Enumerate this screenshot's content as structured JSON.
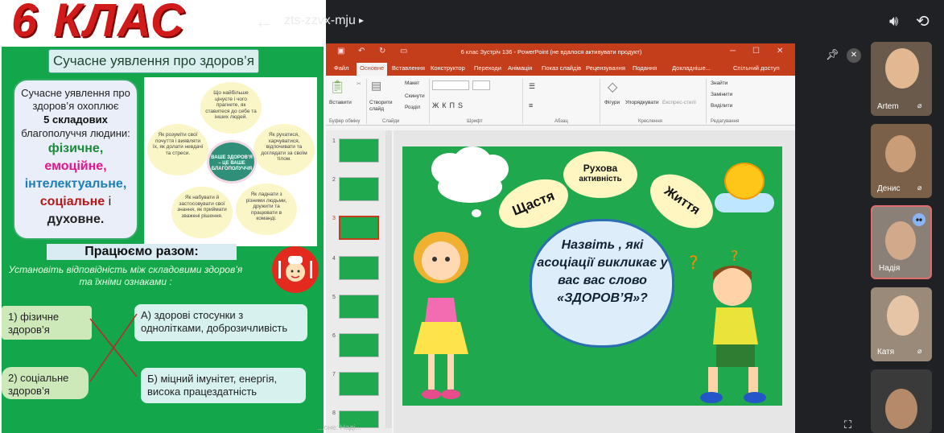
{
  "meeting": {
    "code": "zts-zzvx-mju",
    "participants": [
      {
        "name": "Artem"
      },
      {
        "name": "Денис"
      },
      {
        "name": "Надія"
      },
      {
        "name": "Катя"
      },
      {
        "name": ""
      }
    ],
    "presenter_caption": "...оне: Наді..."
  },
  "lesson": {
    "grade_title": "6 КЛАС",
    "topic_title": "Сучасне уявлення про здоров’я",
    "info": {
      "line1": "Сучасне уявлення про",
      "line2": "здоров’я охоплює",
      "bold": "5 складових",
      "line3": "благополуччя людини:",
      "c1": "фізичне,",
      "c2": "емоційне,",
      "c3": "інтелектуальне,",
      "c4": "соціальне",
      "c4b": " і",
      "c5": "духовне."
    },
    "flower": {
      "center": "ВАШЕ ЗДОРОВ’Я – ЦЕ ВАШЕ БЛАГОПОЛУЧЧЯ",
      "p1": "Що найбільше цінуєте і чого прагнете, як ставитеся до себе та інших людей.",
      "p2": "Як рухатися, харчуватися, відпочивати та доглядати за своїм тілом.",
      "p3": "Як ладнати з різними людьми, дружити та працювати в команді.",
      "p4": "Як набувати й застосовувати свої знання, як приймати зважені рішення.",
      "p5": "Як розуміти свої почуття і виявляти їх, як долати невдачі та стреси."
    },
    "work_title": "Працюємо разом:",
    "instruction": "Установіть відповідність між складовими здоров’я та їхніми ознаками :",
    "match": {
      "m1": "1) фізичне здоров’я",
      "m2": "2) соціальне здоров’я",
      "m3": "А) здорові стосунки з однолітками, доброзичливість",
      "m4": "Б) міцний імунітет, енергія, висока працездатність"
    }
  },
  "ppt": {
    "title": "6 клас Зустріч 136 - PowerPoint (не вдалося активувати продукт)",
    "tabs": [
      "Файл",
      "Основне",
      "Вставлення",
      "Конструктор",
      "Переходи",
      "Анімація",
      "Показ слайдів",
      "Рецензування",
      "Подання",
      "Докладніше...",
      "Спільний доступ"
    ],
    "ribbon": {
      "paste": "Вставити",
      "new_slide": "Створити слайд",
      "layout": "Макет",
      "reset": "Скинути",
      "section": "Розділ",
      "shapes": "Фігури",
      "arrange": "Упорядкувати",
      "quick_styles": "Експрес-стилі",
      "find": "Знайти",
      "replace": "Замінити",
      "select": "Виділити",
      "groups": [
        "Буфер обміну",
        "Слайди",
        "Шрифт",
        "Абзац",
        "Креслення",
        "Редагування"
      ]
    },
    "slide_numbers": [
      "1",
      "2",
      "3",
      "4",
      "5",
      "6",
      "7",
      "8"
    ],
    "slide": {
      "oval_left": "Щастя",
      "oval_mid_1": "Рухова",
      "oval_mid_2": "активність",
      "oval_right": "Життя",
      "question": "Назвіть , які асоціації викликає у вас вас слово «ЗДОРОВ’Я»?"
    }
  },
  "colors": {
    "slide_green": "#1fa84e",
    "ppt_red": "#c43e1c",
    "meet_bg": "#202124"
  }
}
